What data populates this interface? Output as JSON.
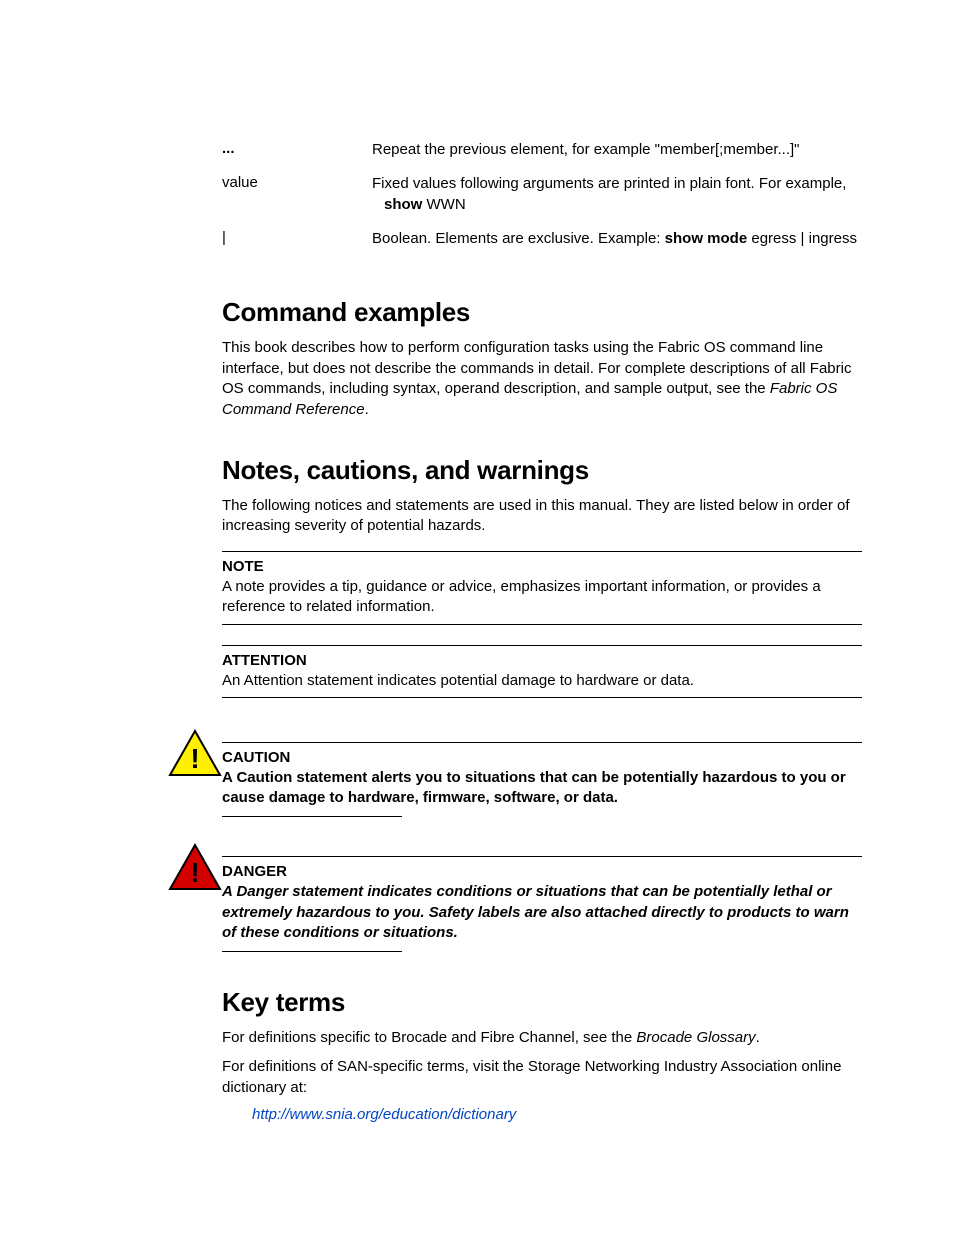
{
  "conventions": [
    {
      "left": "...",
      "leftBold": true,
      "right": "Repeat the previous element, for example \"member[;member...]\""
    },
    {
      "left": "value",
      "leftBold": false,
      "right": "Fixed values following arguments are printed in plain font. For example,",
      "right2_bold": "show",
      "right2_plain": " WWN"
    },
    {
      "left": "|",
      "leftBold": false,
      "right": "Boolean. Elements are exclusive. Example:   ",
      "inline_bold1": "show",
      "inline_sp": "  ",
      "inline_bold2": "mode",
      "inline_plain": " egress | ingress"
    }
  ],
  "headings": {
    "cmd": "Command examples",
    "notes": "Notes, cautions, and warnings",
    "key": "Key terms"
  },
  "paras": {
    "cmd1a": "This book describes how to perform configuration tasks using the Fabric OS command line interface, but does not describe the commands in detail. For complete descriptions of all Fabric OS commands, including syntax, operand description, and sample output, see the ",
    "cmd1i": "Fabric OS Command Reference",
    "cmd1b": ".",
    "notes1": "The following notices and statements are used in this manual. They are listed below in order of increasing severity of potential hazards.",
    "key1a": "For definitions specific to Brocade and Fibre Channel, see the ",
    "key1i": "Brocade Glossary",
    "key1b": ".",
    "key2": "For definitions of SAN-specific terms, visit the Storage Networking Industry Association online dictionary at:",
    "link": "http://www.snia.org/education/dictionary"
  },
  "callouts": {
    "noteT": "NOTE",
    "noteB": "A note provides a tip, guidance or advice, emphasizes important information, or provides a reference to related information.",
    "attT": "ATTENTION",
    "attB": "An Attention statement indicates potential damage to hardware or data.",
    "cauT": "CAUTION",
    "cauB": "A Caution statement alerts you to situations that can be potentially hazardous to you or cause damage to hardware, firmware, software, or data.",
    "danT": "DANGER",
    "danB": "A Danger statement indicates conditions or situations that can be potentially lethal or extremely hazardous to you. Safety labels are also attached directly to products to warn of these conditions or situations."
  }
}
